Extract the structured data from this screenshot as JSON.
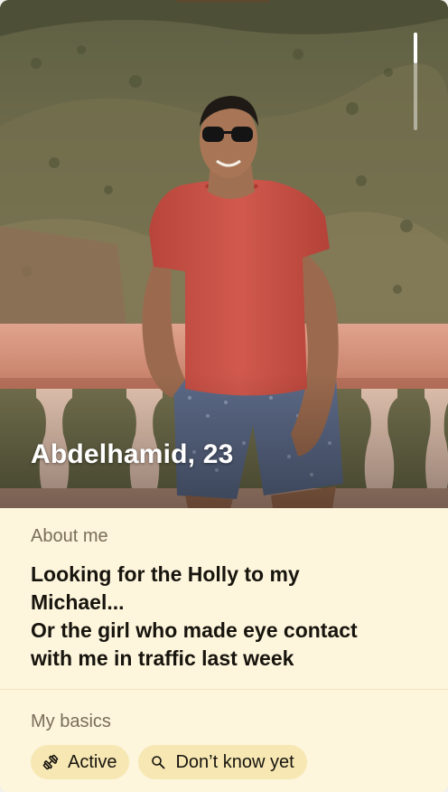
{
  "profile": {
    "name_age": "Abdelhamid, 23",
    "photo": "profile-photo"
  },
  "about": {
    "title": "About me",
    "text": "Looking for the Holly to my\nMichael...\nOr the girl who made eye contact\nwith me in traffic last week"
  },
  "basics": {
    "title": "My basics",
    "chips": [
      {
        "icon": "dumbbell-icon",
        "label": "Active"
      },
      {
        "icon": "search-icon",
        "label": "Don’t know yet"
      }
    ]
  },
  "colors": {
    "card_background": "#fdf5dc",
    "chip_background": "#f6e7b3",
    "section_title": "#7a6e5a",
    "body_text": "#17140e"
  }
}
